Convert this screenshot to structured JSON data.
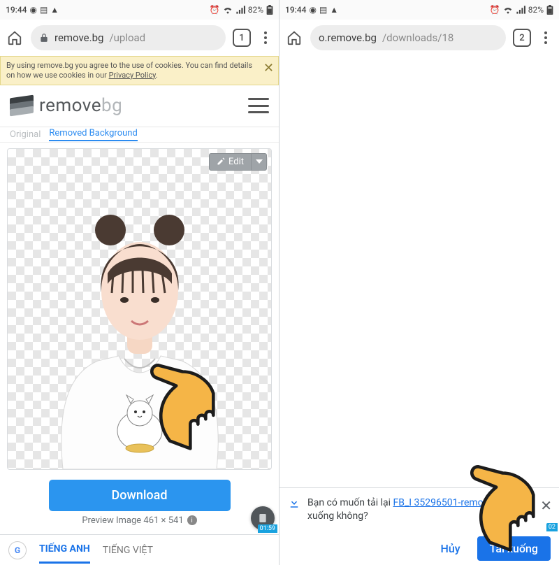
{
  "status": {
    "time": "19:44",
    "battery": "82%"
  },
  "left": {
    "url_host": "remove.bg",
    "url_path": "/upload",
    "tab_count": "1",
    "cookie_text": "By using remove.bg you agree to the use of cookies. You can find details on how we use cookies in our ",
    "cookie_link": "Privacy Policy",
    "logo_a": "remove",
    "logo_b": "bg",
    "tab_original": "Original",
    "tab_removed": "Removed Background",
    "edit_label": "Edit",
    "download_label": "Download",
    "preview_label": "Preview Image 461 × 541",
    "gt_lang1": "TIẾNG ANH",
    "gt_lang2": "TIẾNG VIỆT",
    "vidtag": "01:59"
  },
  "right": {
    "url_host": "o.remove.bg",
    "url_path": "/downloads/18",
    "tab_count": "2",
    "prompt_pre": "Bạn có muốn tải lại ",
    "prompt_file": "FB_I\n35296501-removebg-pr",
    "prompt_post": " xuống không?",
    "cancel": "Hủy",
    "confirm": "Tải xuống",
    "vidtag": "02"
  }
}
